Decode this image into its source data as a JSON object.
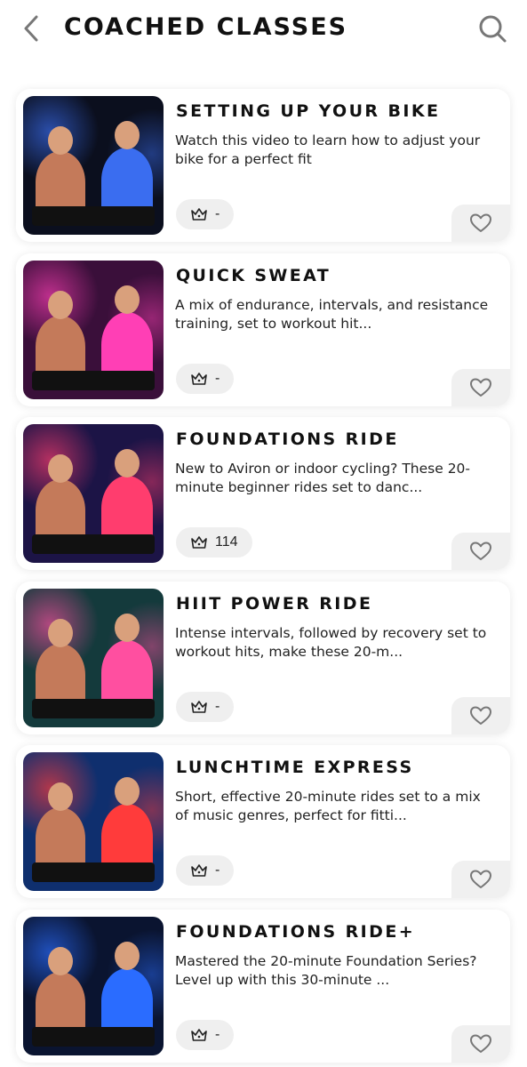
{
  "header": {
    "title": "COACHED CLASSES"
  },
  "classes": [
    {
      "title": "SETTING UP YOUR BIKE",
      "description": "Watch this video to learn how to adjust your bike for a perfect fit",
      "count": "-",
      "thumb": {
        "bg": "#0b0f1e",
        "accent": "#3a6df0"
      }
    },
    {
      "title": "QUICK SWEAT",
      "description": "A mix of endurance, intervals, and resistance training, set to workout hit...",
      "count": "-",
      "thumb": {
        "bg": "#3a0f3a",
        "accent": "#ff3fb5"
      }
    },
    {
      "title": "FOUNDATIONS RIDE",
      "description": "New to Aviron or indoor cycling? These 20-minute beginner rides set to danc...",
      "count": "114",
      "thumb": {
        "bg": "#1c1446",
        "accent": "#ff3d6e"
      }
    },
    {
      "title": "HIIT POWER RIDE",
      "description": "Intense intervals, followed by recovery set to workout hits, make these 20-m...",
      "count": "-",
      "thumb": {
        "bg": "#143a3c",
        "accent": "#ff4fa0"
      }
    },
    {
      "title": "LUNCHTIME EXPRESS",
      "description": "Short, effective 20-minute rides set to a mix of music genres, perfect for fitti...",
      "count": "-",
      "thumb": {
        "bg": "#0f2f6e",
        "accent": "#ff3b3b"
      }
    },
    {
      "title": "FOUNDATIONS RIDE+",
      "description": "Mastered the 20-minute Foundation Series? Level up with this 30-minute ...",
      "count": "-",
      "thumb": {
        "bg": "#0a1430",
        "accent": "#2a6cff"
      }
    }
  ]
}
